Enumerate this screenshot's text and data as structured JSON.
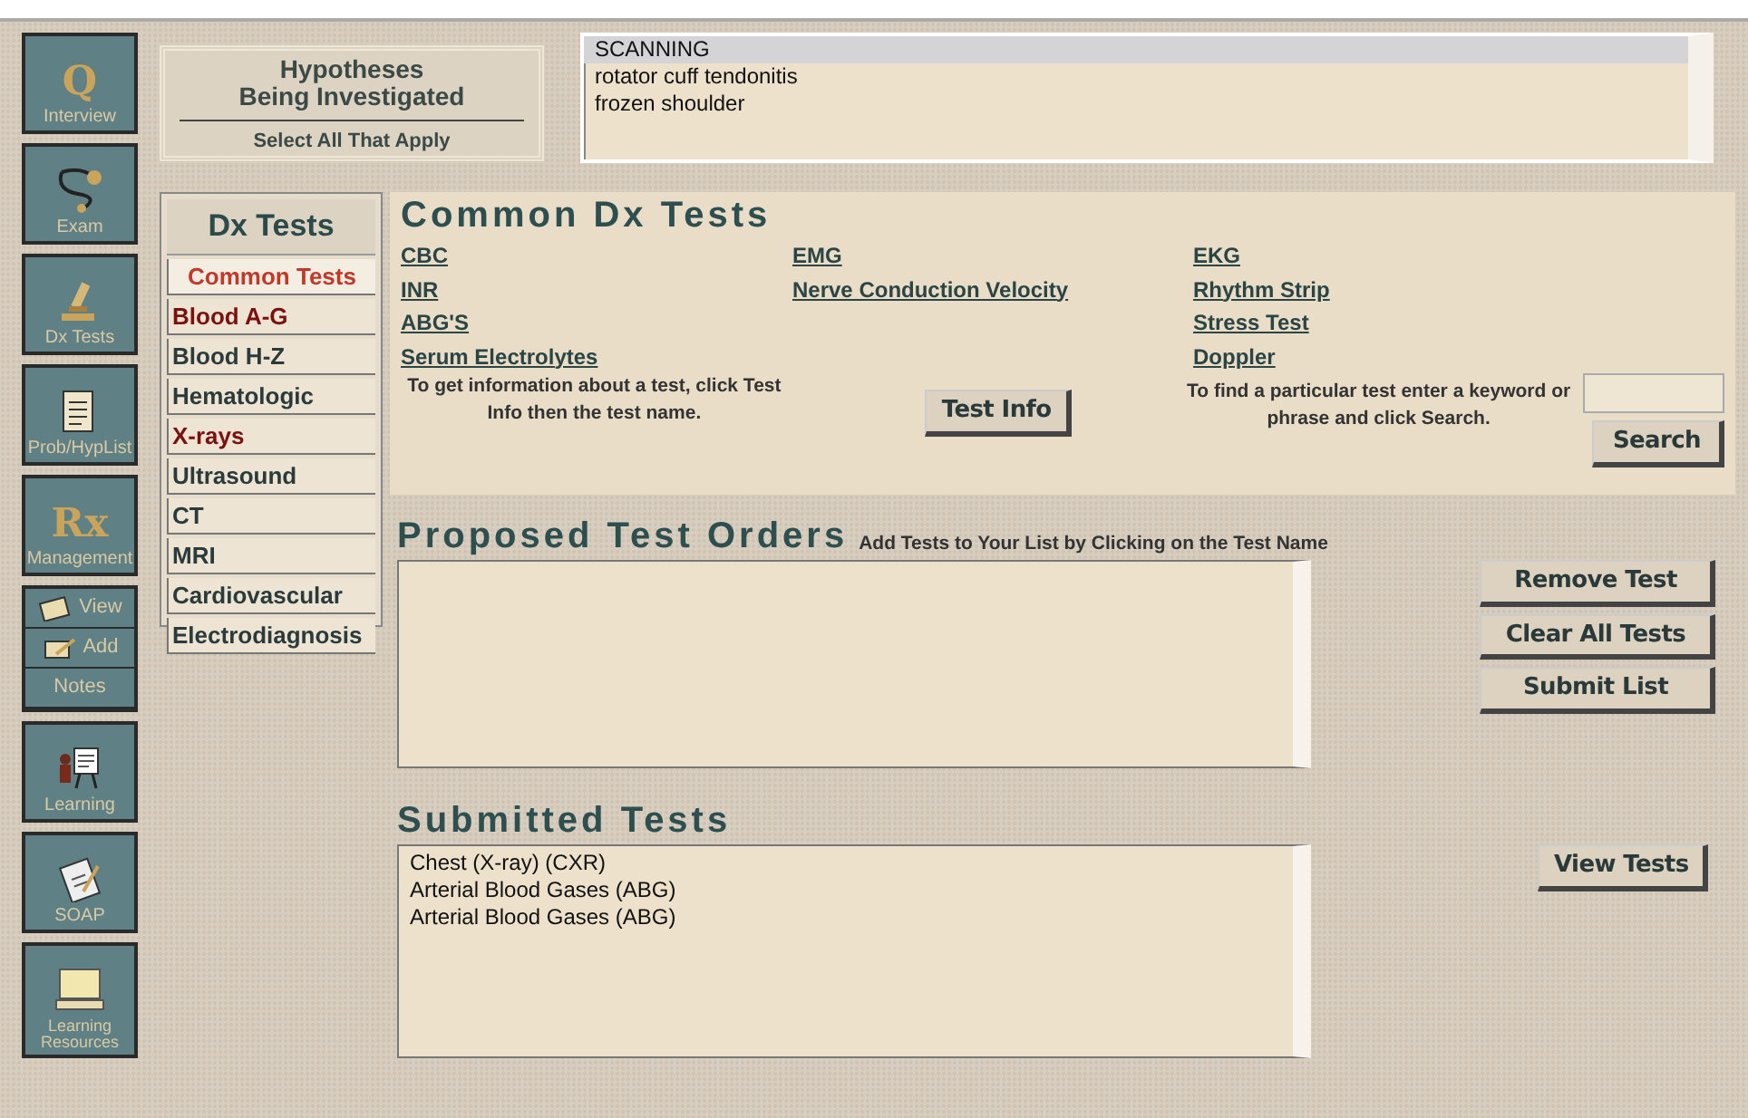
{
  "nav": [
    {
      "kind": "glyph",
      "glyph": "Q",
      "label": "Interview"
    },
    {
      "kind": "stethoscope",
      "label": "Exam"
    },
    {
      "kind": "microscope",
      "label": "Dx Tests"
    },
    {
      "kind": "notepad",
      "label": "Prob/HypList"
    },
    {
      "kind": "glyph",
      "glyph": "Rx",
      "label": "Management"
    },
    {
      "kind": "notes",
      "view": "View",
      "add": "Add",
      "label": "Notes"
    },
    {
      "kind": "easel",
      "label": "Learning"
    },
    {
      "kind": "clipboard",
      "label": "SOAP"
    },
    {
      "kind": "computer",
      "label": "Learning Resources"
    }
  ],
  "hypotheses": {
    "title_1": "Hypotheses",
    "title_2": "Being Investigated",
    "subtitle": "Select All That Apply",
    "items": [
      {
        "label": "SCANNING",
        "selected": true
      },
      {
        "label": "rotator cuff tendonitis",
        "selected": false
      },
      {
        "label": "frozen shoulder",
        "selected": false
      }
    ]
  },
  "categories": {
    "title": "Dx Tests",
    "items": [
      {
        "label": "Common Tests",
        "selected": true,
        "has_orders": false
      },
      {
        "label": "Blood A-G",
        "selected": false,
        "has_orders": true
      },
      {
        "label": "Blood H-Z",
        "selected": false,
        "has_orders": false
      },
      {
        "label": "Hematologic",
        "selected": false,
        "has_orders": false
      },
      {
        "label": "X-rays",
        "selected": false,
        "has_orders": true
      },
      {
        "label": "Ultrasound",
        "selected": false,
        "has_orders": false
      },
      {
        "label": "CT",
        "selected": false,
        "has_orders": false
      },
      {
        "label": "MRI",
        "selected": false,
        "has_orders": false
      },
      {
        "label": "Cardiovascular",
        "selected": false,
        "has_orders": false
      },
      {
        "label": "Electrodiagnosis",
        "selected": false,
        "has_orders": false
      }
    ]
  },
  "common_tests": {
    "title": "Common Dx Tests",
    "columns": [
      [
        "CBC",
        "INR",
        "ABG'S",
        "Serum Electrolytes"
      ],
      [
        "EMG",
        "Nerve Conduction Velocity"
      ],
      [
        "EKG",
        "Rhythm Strip",
        "Stress Test",
        "Doppler"
      ]
    ],
    "info_text": "To get information about a test, click Test Info then the test name.",
    "info_button": "Test Info",
    "search_text": "To find a particular test enter a keyword or phrase and click Search.",
    "search_button": "Search"
  },
  "proposed": {
    "title": "Proposed Test Orders",
    "hint": "Add Tests to Your List by Clicking on the Test Name",
    "buttons": [
      "Remove Test",
      "Clear All Tests",
      "Submit List"
    ]
  },
  "submitted": {
    "title": "Submitted Tests",
    "items": [
      "Chest (X-ray) (CXR)",
      "Arterial Blood Gases (ABG)",
      "Arterial Blood Gases (ABG)"
    ],
    "button": "View Tests"
  }
}
